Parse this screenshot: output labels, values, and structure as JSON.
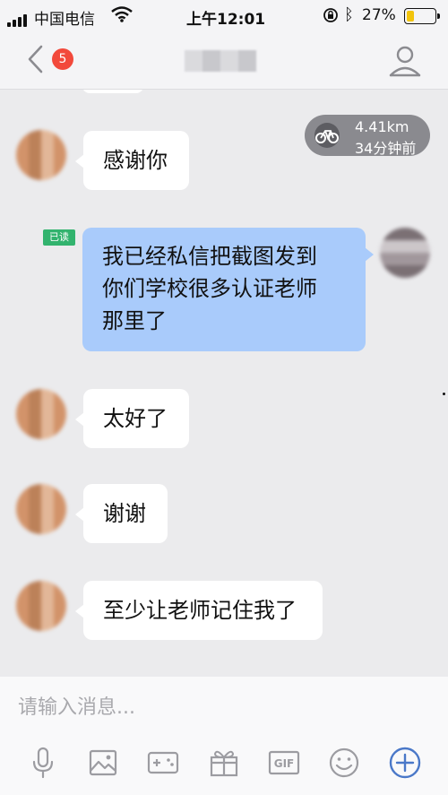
{
  "status_bar": {
    "carrier": "中国电信",
    "time": "上午12:01",
    "battery_percent": "27%",
    "battery_level": 0.27,
    "icons": [
      "signal-icon",
      "wifi-icon",
      "orientation-lock-icon",
      "bluetooth-icon",
      "battery-icon"
    ]
  },
  "nav": {
    "unread_count": "5",
    "icons": [
      "chevron-left-icon",
      "profile-icon"
    ]
  },
  "distance": {
    "km": "4.41km",
    "ago": "34分钟前",
    "icon": "bicycle-icon"
  },
  "messages": [
    {
      "from": "other",
      "text": "感谢你"
    },
    {
      "from": "self",
      "read_label": "已读",
      "lines": [
        "我已经私信把截图发到",
        "你们学校很多认证老师",
        "那里了"
      ]
    },
    {
      "from": "other",
      "text": "太好了"
    },
    {
      "from": "other",
      "text": "谢谢"
    },
    {
      "from": "other",
      "text": "至少让老师记住我了"
    }
  ],
  "composer": {
    "placeholder": "请输入消息...",
    "toolbar_icons": [
      "microphone-icon",
      "image-icon",
      "game-icon",
      "gift-icon",
      "gif-icon",
      "emoji-icon",
      "plus-icon"
    ],
    "gif_label": "GIF"
  },
  "colors": {
    "self_bubble": "#a9cbfb",
    "badge": "#f2493b",
    "read_tag": "#32b36e",
    "accent": "#4a78c8"
  }
}
